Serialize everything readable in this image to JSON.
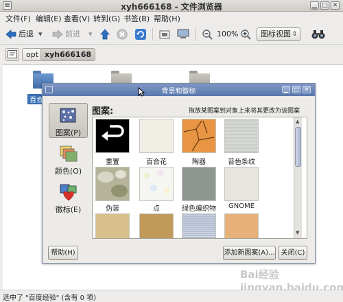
{
  "window": {
    "title": "xyh666168 - 文件浏览器"
  },
  "menubar": {
    "items": [
      "文件(F)",
      "编辑(E)",
      "查看(V)",
      "转到(G)",
      "书签(B)",
      "帮助(H)"
    ]
  },
  "toolbar": {
    "back": "后退",
    "forward": "前进",
    "zoom": "100%",
    "view_mode": "图标视图"
  },
  "location": {
    "crumbs": [
      "opt",
      "xyh666168"
    ]
  },
  "folders": [
    {
      "label": "百合"
    }
  ],
  "status": {
    "text": "选中了 \"百度经验\" (含有 0 项)"
  },
  "watermark": "Bai经验 jingyan.baidu.com",
  "dialog": {
    "title": "背景和徽标",
    "heading": "图案:",
    "hint": "拖放某图案到对象上来将其更改为该图案",
    "categories": [
      {
        "label": "图案(P)"
      },
      {
        "label": "颜色(O)"
      },
      {
        "label": "徽标(E)"
      }
    ],
    "patterns": [
      {
        "label": "重置",
        "color": "#000000"
      },
      {
        "label": "百合花",
        "color": "#f1eee6"
      },
      {
        "label": "陶器",
        "color": "#e79543"
      },
      {
        "label": "苔色条纹",
        "color": "#d6d9d3"
      },
      {
        "label": "伪装",
        "color": "#b5b49b"
      },
      {
        "label": "点",
        "color": "#f5f5f2"
      },
      {
        "label": "绿色编织物",
        "color": "#8f9791"
      },
      {
        "label": "GNOME",
        "color": "#e7e5e0"
      },
      {
        "label": "",
        "color": "#d7c08c"
      },
      {
        "label": "",
        "color": "#c19a5a"
      },
      {
        "label": "",
        "color": "#b4bdd2"
      },
      {
        "label": "",
        "color": "#e6b178"
      }
    ],
    "help_btn": "帮助(H)",
    "add_btn": "添加新图案(A)...",
    "close_btn": "关闭(C)"
  }
}
